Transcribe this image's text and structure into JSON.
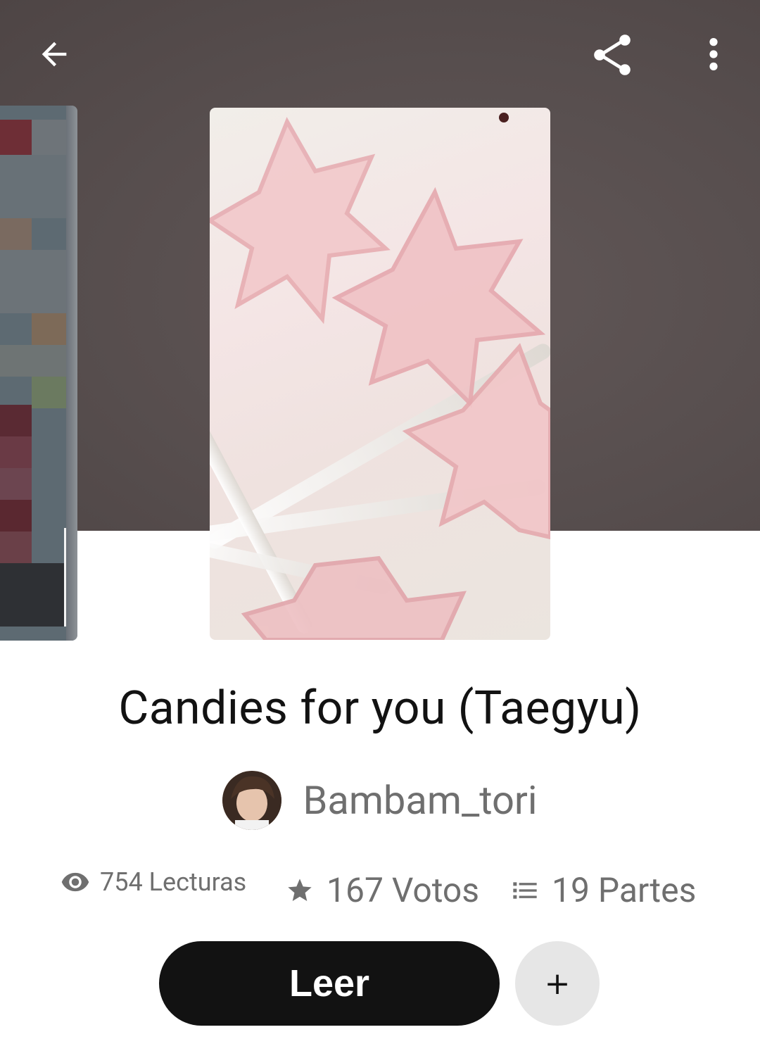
{
  "header": {
    "back_icon": "arrow-back-icon",
    "share_icon": "share-icon",
    "more_icon": "more-vertical-icon",
    "background_color": "#574e4e"
  },
  "story": {
    "title": "Candies for you (Taegyu)",
    "author": "Bambam_tori",
    "cover_description_icon": "pink-star-lollipops-image"
  },
  "stats": {
    "reads_icon": "eye-icon",
    "reads": "754 Lecturas",
    "votes_icon": "star-icon",
    "votes": "167 Votos",
    "parts_icon": "list-icon",
    "parts": "19 Partes"
  },
  "actions": {
    "read_label": "Leer",
    "add_label": "+"
  },
  "colors": {
    "primary_button": "#121212",
    "secondary_button": "#e6e6e6",
    "muted_text": "#6f6f6f",
    "title_text": "#121212"
  }
}
